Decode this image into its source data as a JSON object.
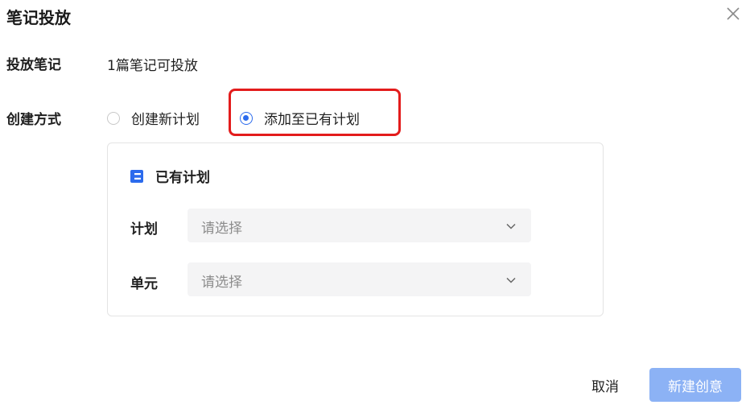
{
  "dialog": {
    "title": "笔记投放",
    "close_icon": "close-icon"
  },
  "notes_row": {
    "label": "投放笔记",
    "value": "1篇笔记可投放"
  },
  "create_mode": {
    "label": "创建方式",
    "options": [
      {
        "label": "创建新计划",
        "checked": false
      },
      {
        "label": "添加至已有计划",
        "checked": true
      }
    ],
    "highlight_color": "#e31c1c",
    "accent_color": "#2c6bed"
  },
  "existing_plan": {
    "title": "已有计划",
    "icon": "plan-icon",
    "fields": [
      {
        "label": "计划",
        "placeholder": "请选择"
      },
      {
        "label": "单元",
        "placeholder": "请选择"
      }
    ]
  },
  "footer": {
    "cancel_label": "取消",
    "create_label": "新建创意",
    "create_color": "#8cb2f5"
  }
}
